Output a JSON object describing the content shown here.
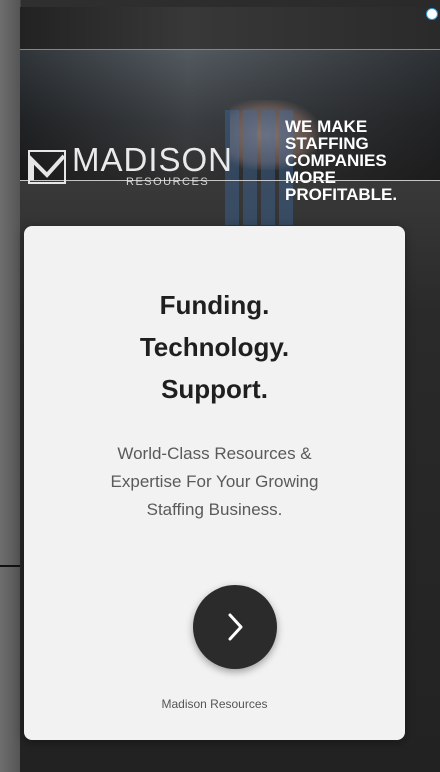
{
  "ad": {
    "banner": {
      "logo_name": "MADISON",
      "logo_sub": "RESOURCES",
      "tagline_lines": [
        "WE MAKE",
        "STAFFING",
        "COMPANIES",
        "MORE",
        "PROFITABLE."
      ]
    },
    "card": {
      "title_lines": [
        "Funding.",
        "Technology.",
        "Support."
      ],
      "subtitle_lines": [
        "World-Class Resources &",
        "Expertise For Your Growing",
        "Staffing Business."
      ],
      "cta_icon": "chevron-right-icon",
      "brand": "Madison Resources"
    },
    "ad_choices_icon": "ad-choices-icon"
  },
  "colors": {
    "card_bg": "#f2f2f2",
    "cta_bg": "#2b2b2b",
    "title": "#1f1f1f",
    "subtitle": "#5a5a5a",
    "ad_choices": "#2d9cdb"
  }
}
